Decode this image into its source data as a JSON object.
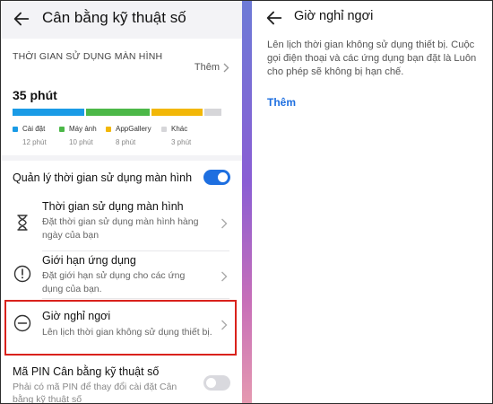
{
  "left": {
    "header": {
      "title": "Cân bằng kỹ thuật số"
    },
    "summary": {
      "section_label": "THỜI GIAN SỬ DỤNG MÀN HÌNH",
      "more_label": "Thêm",
      "total": "35 phút",
      "segments": [
        {
          "name": "Cài đặt",
          "time": "12 phút",
          "color": "#1a9be6",
          "fraction": 0.34
        },
        {
          "name": "Máy ảnh",
          "time": "10 phút",
          "color": "#4cb848",
          "fraction": 0.3
        },
        {
          "name": "AppGallery",
          "time": "8 phút",
          "color": "#f2b707",
          "fraction": 0.24
        },
        {
          "name": "Khác",
          "time": "3 phút",
          "color": "#d6d6d9",
          "fraction": 0.08
        }
      ]
    },
    "manage": {
      "label": "Quản lý thời gian sử dụng màn hình",
      "enabled": true
    },
    "items": [
      {
        "title": "Thời gian sử dụng màn hình",
        "desc": "Đặt thời gian sử dụng màn hình hàng ngày của bạn",
        "icon": "hourglass-icon"
      },
      {
        "title": "Giới hạn ứng dụng",
        "desc": "Đặt giới hạn sử dụng cho các ứng dụng của bạn.",
        "icon": "alert-circle-icon"
      },
      {
        "title": "Giờ nghỉ ngơi",
        "desc": "Lên lịch thời gian không sử dụng thiết bị.",
        "icon": "minus-circle-icon"
      }
    ],
    "pin": {
      "title": "Mã PIN Cân bằng kỹ thuật số",
      "desc": "Phải có mã PIN để thay đổi cài đặt Cân bằng kỹ thuật số",
      "enabled": false
    }
  },
  "right": {
    "title": "Giờ nghỉ ngơi",
    "desc": "Lên lịch thời gian không sử dụng thiết bị. Cuộc gọi điện thoại và các ứng dụng bạn đặt là Luôn cho phép sẽ không bị hạn chế.",
    "add_label": "Thêm"
  },
  "colors": {
    "accent": "#1e6fe0",
    "highlight": "#d9221c"
  }
}
